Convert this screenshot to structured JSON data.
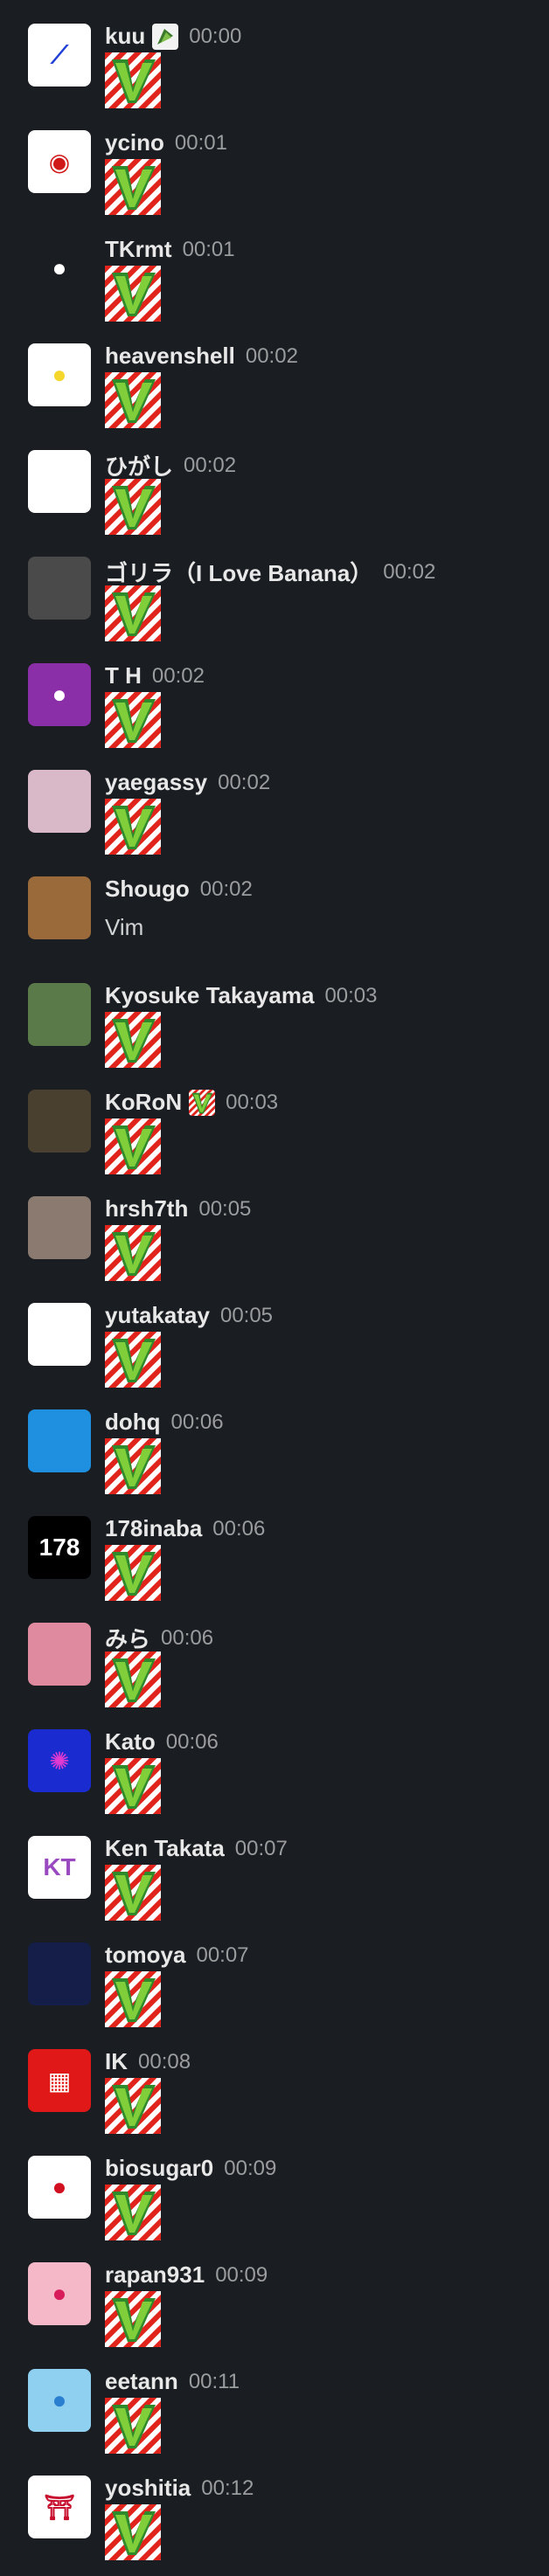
{
  "messages": [
    {
      "user": "kuu",
      "time": "00:00",
      "avatar_icon": "abstract-blue-logo-icon",
      "avatar_bg": "#ffffff",
      "avatar_fg": "#1f3fd6",
      "status_icon": "leaf-emoji-icon",
      "body": "vim-emoji"
    },
    {
      "user": "ycino",
      "time": "00:01",
      "avatar_icon": "film-reel-icon",
      "avatar_bg": "#ffffff",
      "avatar_fg": "#d01818",
      "body": "vim-emoji"
    },
    {
      "user": "TKrmt",
      "time": "00:01",
      "avatar_icon": "person-silhouette-icon",
      "avatar_bg": "#1a1d21",
      "avatar_fg": "#ffffff",
      "body": "vim-emoji"
    },
    {
      "user": "heavenshell",
      "time": "00:02",
      "avatar_icon": "yellow-chick-icon",
      "avatar_bg": "#ffffff",
      "avatar_fg": "#f5d62b",
      "body": "vim-emoji"
    },
    {
      "user": "ひがし",
      "time": "00:02",
      "avatar_icon": "anime-face-icon",
      "avatar_bg": "#ffffff",
      "avatar_fg": "#222222",
      "body": "vim-emoji"
    },
    {
      "user": "ゴリラ（I Love Banana）",
      "time": "00:02",
      "avatar_icon": "gorilla-santa-hat-icon",
      "avatar_bg": "#4a4a4a",
      "avatar_fg": "#d11a1a",
      "body": "vim-emoji"
    },
    {
      "user": "T H",
      "time": "00:02",
      "avatar_icon": "default-person-icon",
      "avatar_bg": "#8a2fa8",
      "avatar_fg": "#ffffff",
      "body": "vim-emoji"
    },
    {
      "user": "yaegassy",
      "time": "00:02",
      "avatar_icon": "cartoon-laptop-person-icon",
      "avatar_bg": "#d9b8c7",
      "avatar_fg": "#333333",
      "body": "vim-emoji"
    },
    {
      "user": "Shougo",
      "time": "00:02",
      "avatar_icon": "claw-art-icon",
      "avatar_bg": "#9a6a3a",
      "avatar_fg": "#ffffff",
      "body_text": "Vim"
    },
    {
      "user": "Kyosuke Takayama",
      "time": "00:03",
      "avatar_icon": "outdoor-photo-icon",
      "avatar_bg": "#5a7a4a",
      "avatar_fg": "#c03070",
      "body": "vim-emoji"
    },
    {
      "user": "KoRoN",
      "time": "00:03",
      "avatar_icon": "cat-photo-icon",
      "avatar_bg": "#4a4030",
      "avatar_fg": "#ddd2c0",
      "status_icon": "vim-status-icon",
      "body": "vim-emoji"
    },
    {
      "user": "hrsh7th",
      "time": "00:05",
      "avatar_icon": "sketch-photo-icon",
      "avatar_bg": "#8a7a70",
      "avatar_fg": "#f0e0d0",
      "body": "vim-emoji"
    },
    {
      "user": "yutakatay",
      "time": "00:05",
      "avatar_icon": "line-drawing-face-icon",
      "avatar_bg": "#ffffff",
      "avatar_fg": "#111111",
      "body": "vim-emoji"
    },
    {
      "user": "dohq",
      "time": "00:06",
      "avatar_icon": "pixel-character-icon",
      "avatar_bg": "#1f8fe0",
      "avatar_fg": "#111111",
      "body": "vim-emoji"
    },
    {
      "user": "178inaba",
      "time": "00:06",
      "avatar_icon": "text-logo-icon",
      "avatar_bg": "#000000",
      "avatar_fg": "#ffffff",
      "body": "vim-emoji"
    },
    {
      "user": "みら",
      "time": "00:06",
      "avatar_icon": "anime-girl-icon",
      "avatar_bg": "#e08aa0",
      "avatar_fg": "#6b3b2a",
      "body": "vim-emoji"
    },
    {
      "user": "Kato",
      "time": "00:06",
      "avatar_icon": "jellyfish-icon",
      "avatar_bg": "#1a2bd0",
      "avatar_fg": "#e03ad0",
      "body": "vim-emoji"
    },
    {
      "user": "Ken Takata",
      "time": "00:07",
      "avatar_icon": "kt-monogram-icon",
      "avatar_bg": "#ffffff",
      "avatar_fg": "#9a4ac0",
      "body": "vim-emoji"
    },
    {
      "user": "tomoya",
      "time": "00:07",
      "avatar_icon": "crest-icon",
      "avatar_bg": "#141e48",
      "avatar_fg": "#c9a040",
      "body": "vim-emoji"
    },
    {
      "user": "IK",
      "time": "00:08",
      "avatar_icon": "space-invader-icon",
      "avatar_bg": "#e01818",
      "avatar_fg": "#ffffff",
      "body": "vim-emoji"
    },
    {
      "user": "biosugar0",
      "time": "00:09",
      "avatar_icon": "red-apple-icon",
      "avatar_bg": "#ffffff",
      "avatar_fg": "#d01020",
      "body": "vim-emoji"
    },
    {
      "user": "rapan931",
      "time": "00:09",
      "avatar_icon": "default-person-icon",
      "avatar_bg": "#f4b8c8",
      "avatar_fg": "#d81b5a",
      "body": "vim-emoji"
    },
    {
      "user": "eetann",
      "time": "00:11",
      "avatar_icon": "hot-air-balloon-icon",
      "avatar_bg": "#8fd0f0",
      "avatar_fg": "#2a7fd0",
      "body": "vim-emoji"
    },
    {
      "user": "yoshitia",
      "time": "00:12",
      "avatar_icon": "torii-gate-icon",
      "avatar_bg": "#ffffff",
      "avatar_fg": "#c8102e",
      "body": "vim-emoji"
    }
  ]
}
